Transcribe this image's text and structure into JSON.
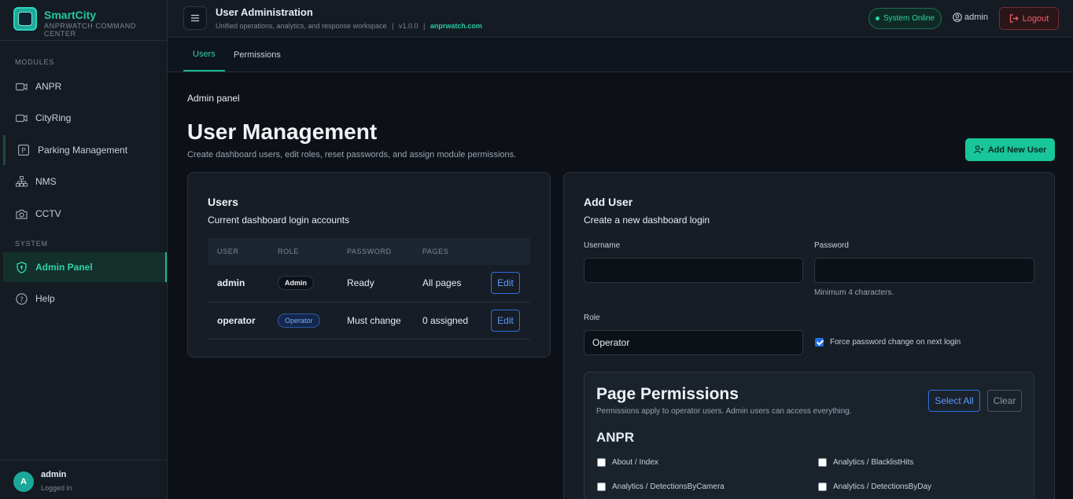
{
  "brand": {
    "name": "SmartCity",
    "subtitle": "ANPRWATCH COMMAND CENTER"
  },
  "sidebar": {
    "modules_label": "MODULES",
    "system_label": "SYSTEM",
    "modules": [
      {
        "label": "ANPR",
        "icon": "camera-icon"
      },
      {
        "label": "CityRing",
        "icon": "camera-icon"
      },
      {
        "label": "Parking Management",
        "icon": "parking-icon"
      },
      {
        "label": "NMS",
        "icon": "network-icon"
      },
      {
        "label": "CCTV",
        "icon": "cctv-icon"
      }
    ],
    "system": [
      {
        "label": "Admin Panel",
        "icon": "shield-icon",
        "active": true
      },
      {
        "label": "Help",
        "icon": "help-icon"
      }
    ],
    "footer": {
      "avatar_letter": "A",
      "name": "admin",
      "status": "Logged in"
    }
  },
  "header": {
    "title": "User Administration",
    "subtitle": "Unified operations, analytics, and response workspace",
    "version": "v1.0.0",
    "domain": "anprwatch.com",
    "status": "System Online",
    "user": "admin",
    "logout": "Logout"
  },
  "tabs": [
    {
      "label": "Users",
      "active": true
    },
    {
      "label": "Permissions",
      "active": false
    }
  ],
  "page": {
    "crumb": "Admin panel",
    "title": "User Management",
    "subtitle": "Create dashboard users, edit roles, reset passwords, and assign module permissions.",
    "add_button": "Add New User"
  },
  "users_card": {
    "title": "Users",
    "subtitle": "Current dashboard login accounts",
    "columns": [
      "USER",
      "ROLE",
      "PASSWORD",
      "PAGES"
    ],
    "rows": [
      {
        "user": "admin",
        "role": "Admin",
        "password": "Ready",
        "pages": "All pages",
        "action": "Edit"
      },
      {
        "user": "operator",
        "role": "Operator",
        "password": "Must change",
        "pages": "0 assigned",
        "action": "Edit"
      }
    ]
  },
  "add_user": {
    "title": "Add User",
    "subtitle": "Create a new dashboard login",
    "username_label": "Username",
    "username_value": "",
    "password_label": "Password",
    "password_value": "",
    "password_hint": "Minimum 4 characters.",
    "role_label": "Role",
    "role_value": "Operator",
    "force_change_label": "Force password change on next login",
    "force_change_checked": true
  },
  "permissions": {
    "title": "Page Permissions",
    "subtitle": "Permissions apply to operator users. Admin users can access everything.",
    "select_all": "Select All",
    "clear": "Clear",
    "group": "ANPR",
    "items": [
      "About / Index",
      "Analytics / BlacklistHits",
      "Analytics / DetectionsByCamera",
      "Analytics / DetectionsByDay"
    ]
  },
  "colors": {
    "accent": "#1cb98f",
    "background": "#0d1117",
    "panel": "#161d26",
    "danger": "#f0616d",
    "link_blue": "#5b9bff"
  }
}
